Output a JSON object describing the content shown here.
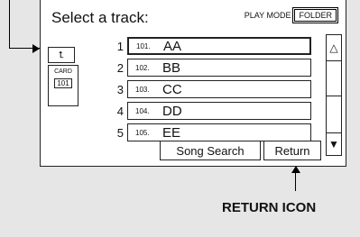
{
  "screen": {
    "title": "Select a track:",
    "play_mode_label": "PLAY MODE",
    "folder_button": "FOLDER"
  },
  "side_panel": {
    "up_icon": "up-folder-icon",
    "card_label": "CARD",
    "card_folder_number": "101"
  },
  "tracks": [
    {
      "index": "1",
      "code": "101.",
      "name": "AA",
      "selected": true
    },
    {
      "index": "2",
      "code": "102.",
      "name": "BB"
    },
    {
      "index": "3",
      "code": "103.",
      "name": "CC"
    },
    {
      "index": "4",
      "code": "104.",
      "name": "DD"
    },
    {
      "index": "5",
      "code": "105.",
      "name": "EE"
    }
  ],
  "buttons": {
    "song_search": "Song Search",
    "return": "Return"
  },
  "scrollbar": {
    "up_icon": "△",
    "down_icon": "▼"
  },
  "annotation": {
    "return_caption": "RETURN ICON"
  }
}
